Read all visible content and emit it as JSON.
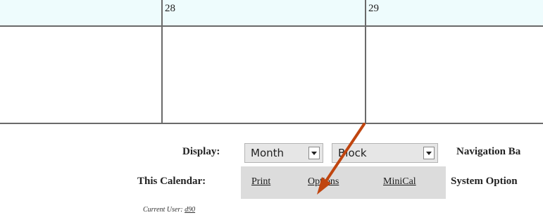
{
  "calendar": {
    "days": [
      "28",
      "29"
    ]
  },
  "controls": {
    "display_label": "Display:",
    "display_view": "Month",
    "display_style": "Block",
    "navigation_label": "Navigation Ba",
    "this_calendar_label": "This Calendar:",
    "links": [
      "Print",
      "Options",
      "MiniCal"
    ],
    "system_options_label": "System Option"
  },
  "footer": {
    "current_user_label": "Current User:",
    "current_user_value": "d90"
  },
  "colors": {
    "header_row": "#eefcfd",
    "grid_line": "#6a6a6a",
    "link_bar": "#dcdcdc",
    "arrow": "#c0450f"
  },
  "icons": [
    "dropdown-arrow-icon",
    "annotation-arrow-icon"
  ]
}
